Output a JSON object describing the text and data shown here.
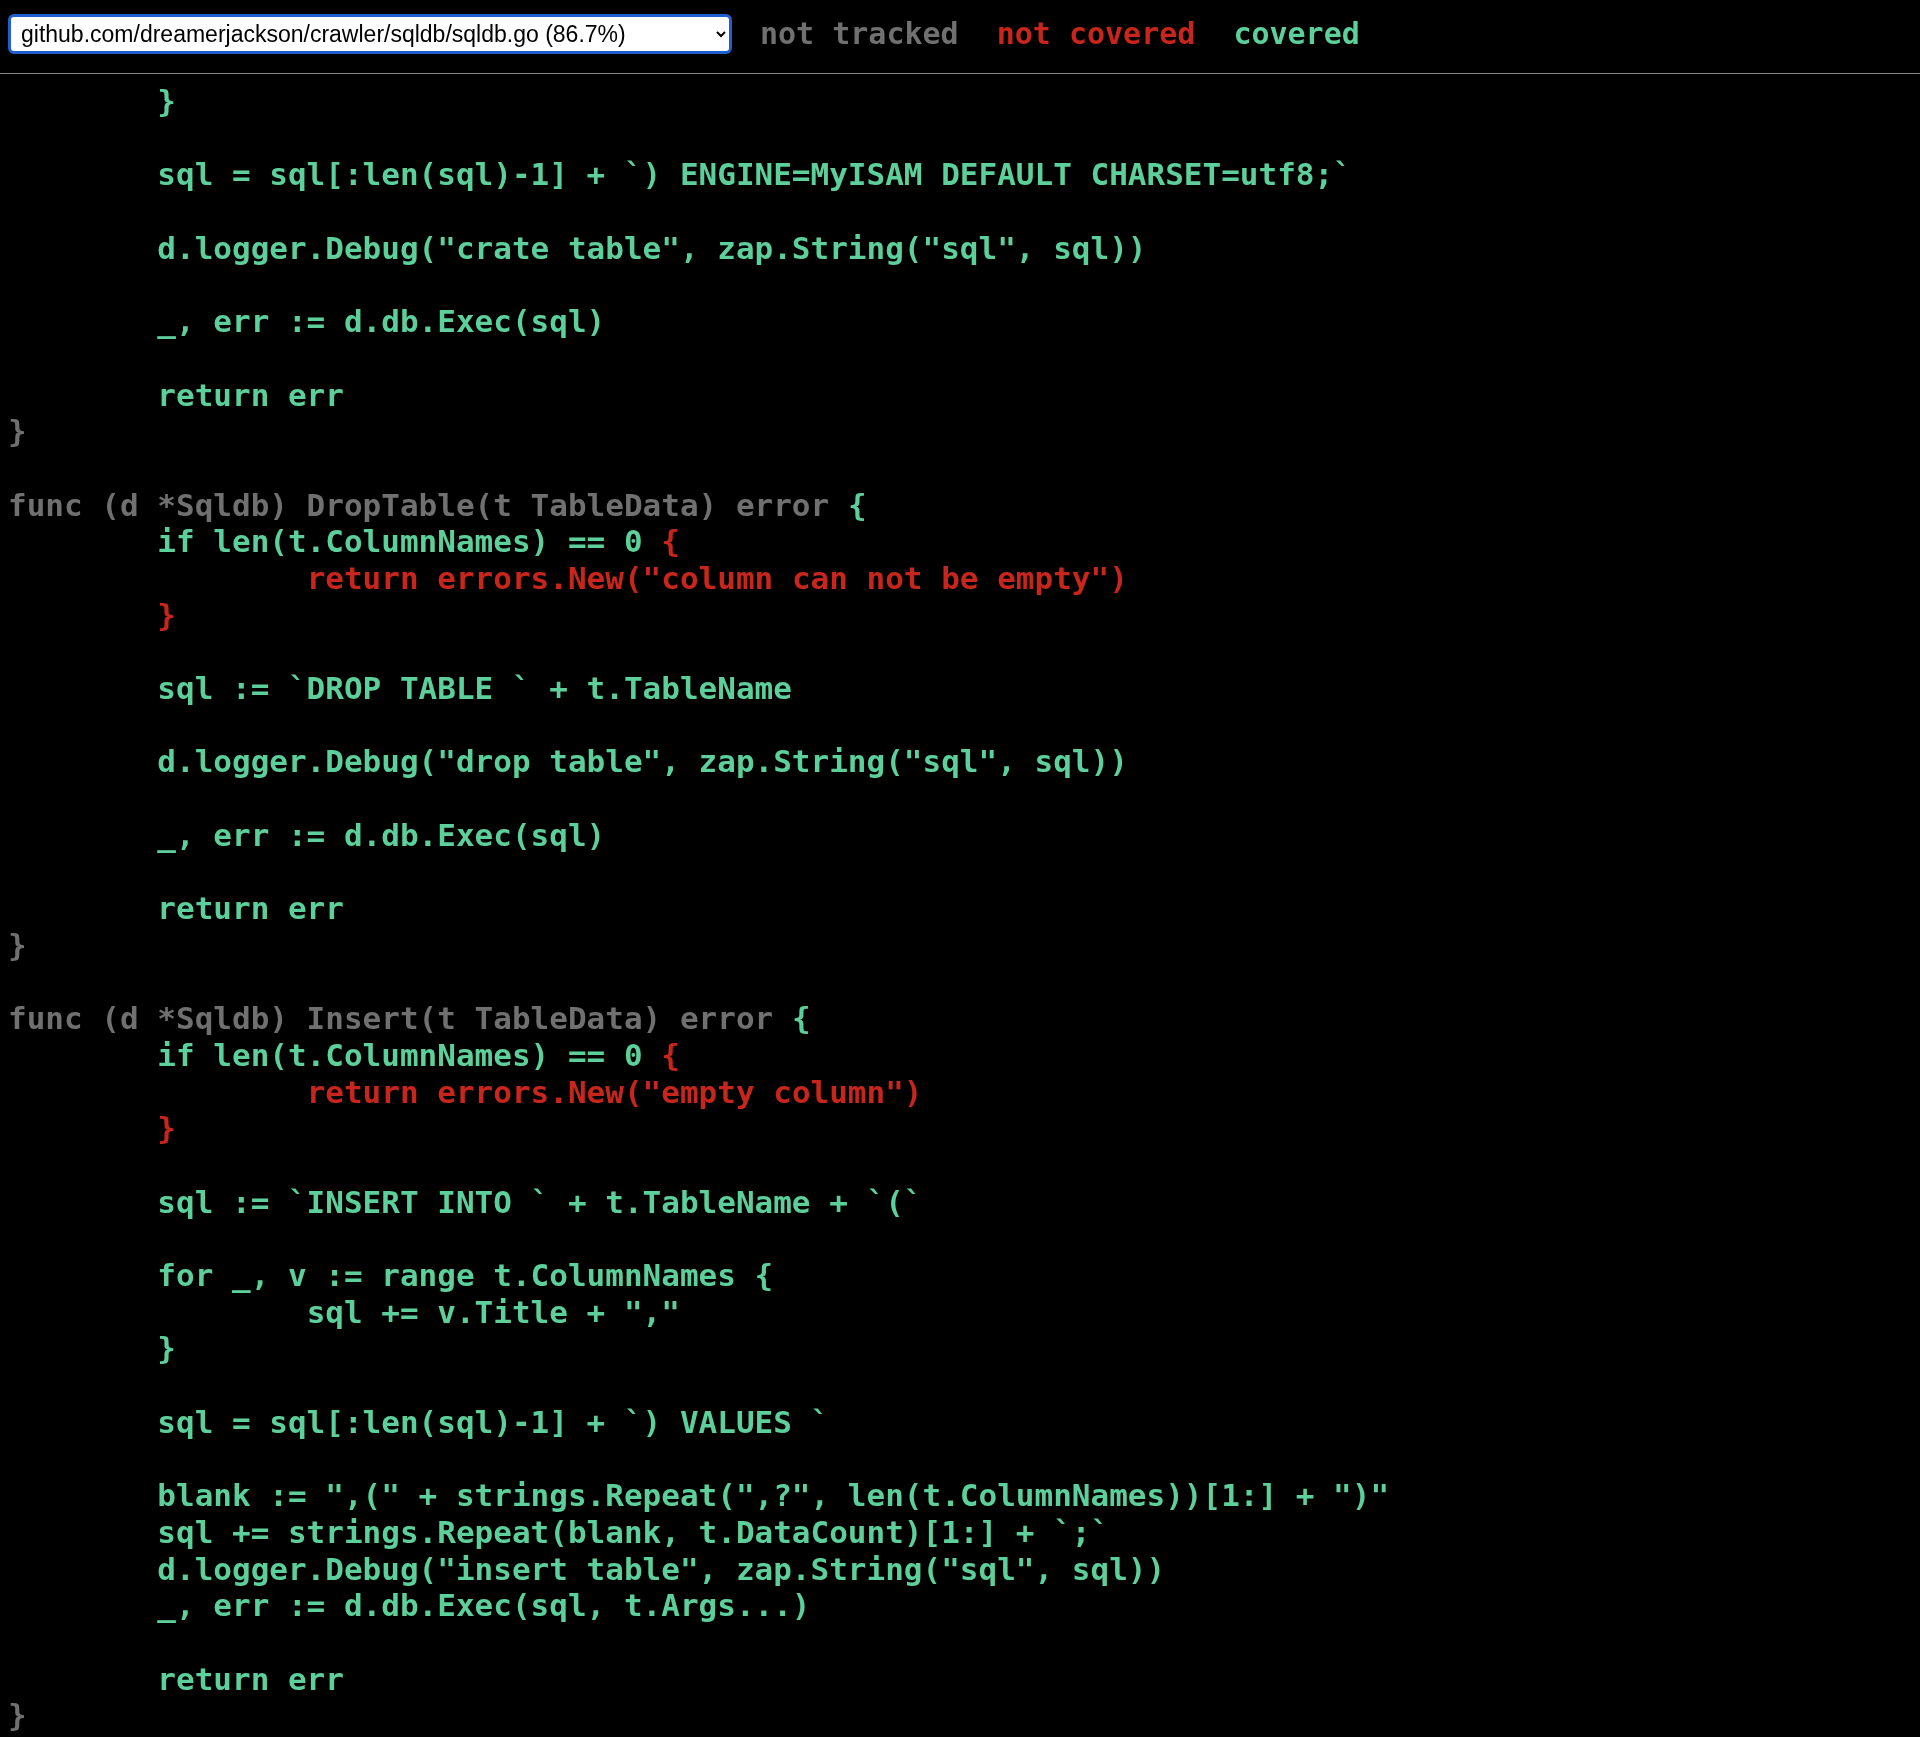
{
  "header": {
    "file_select": {
      "value": "github.com/dreamerjackson/crawler/sqldb/sqldb.go (86.7%)"
    },
    "legend": [
      {
        "label": "not tracked",
        "kind": "not-tracked"
      },
      {
        "label": "not covered",
        "kind": "not-covered"
      },
      {
        "label": "covered",
        "kind": "covered"
      }
    ]
  },
  "code": {
    "lines": [
      {
        "kind": "code",
        "segments": [
          {
            "text": "\t}",
            "kind": "covered"
          }
        ]
      },
      {
        "kind": "blank"
      },
      {
        "kind": "code",
        "segments": [
          {
            "text": "\tsql = sql[:len(sql)-1] + `) ENGINE=MyISAM DEFAULT CHARSET=utf8;`",
            "kind": "covered"
          }
        ]
      },
      {
        "kind": "blank"
      },
      {
        "kind": "code",
        "segments": [
          {
            "text": "\td.logger.Debug(\"crate table\", zap.String(\"sql\", sql))",
            "kind": "covered"
          }
        ]
      },
      {
        "kind": "blank"
      },
      {
        "kind": "code",
        "segments": [
          {
            "text": "\t_, err := d.db.Exec(sql)",
            "kind": "covered"
          }
        ]
      },
      {
        "kind": "blank"
      },
      {
        "kind": "code",
        "segments": [
          {
            "text": "\treturn err",
            "kind": "covered"
          }
        ]
      },
      {
        "kind": "code",
        "segments": [
          {
            "text": "}",
            "kind": "not-tracked"
          }
        ]
      },
      {
        "kind": "blank"
      },
      {
        "kind": "code",
        "segments": [
          {
            "text": "func (d *Sqldb) DropTable(t TableData) error ",
            "kind": "not-tracked"
          },
          {
            "text": "{",
            "kind": "covered"
          }
        ]
      },
      {
        "kind": "code",
        "segments": [
          {
            "text": "\tif len(t.ColumnNames) == 0 ",
            "kind": "covered"
          },
          {
            "text": "{",
            "kind": "not-covered"
          }
        ]
      },
      {
        "kind": "code",
        "segments": [
          {
            "text": "\t\treturn errors.New(\"column can not be empty\")",
            "kind": "not-covered"
          }
        ]
      },
      {
        "kind": "code",
        "segments": [
          {
            "text": "\t}",
            "kind": "not-covered"
          }
        ]
      },
      {
        "kind": "blank"
      },
      {
        "kind": "code",
        "segments": [
          {
            "text": "\tsql := `DROP TABLE ` + t.TableName",
            "kind": "covered"
          }
        ]
      },
      {
        "kind": "blank"
      },
      {
        "kind": "code",
        "segments": [
          {
            "text": "\td.logger.Debug(\"drop table\", zap.String(\"sql\", sql))",
            "kind": "covered"
          }
        ]
      },
      {
        "kind": "blank"
      },
      {
        "kind": "code",
        "segments": [
          {
            "text": "\t_, err := d.db.Exec(sql)",
            "kind": "covered"
          }
        ]
      },
      {
        "kind": "blank"
      },
      {
        "kind": "code",
        "segments": [
          {
            "text": "\treturn err",
            "kind": "covered"
          }
        ]
      },
      {
        "kind": "code",
        "segments": [
          {
            "text": "}",
            "kind": "not-tracked"
          }
        ]
      },
      {
        "kind": "blank"
      },
      {
        "kind": "code",
        "segments": [
          {
            "text": "func (d *Sqldb) Insert(t TableData) error ",
            "kind": "not-tracked"
          },
          {
            "text": "{",
            "kind": "covered"
          }
        ]
      },
      {
        "kind": "code",
        "segments": [
          {
            "text": "\tif len(t.ColumnNames) == 0 ",
            "kind": "covered"
          },
          {
            "text": "{",
            "kind": "not-covered"
          }
        ]
      },
      {
        "kind": "code",
        "segments": [
          {
            "text": "\t\treturn errors.New(\"empty column\")",
            "kind": "not-covered"
          }
        ]
      },
      {
        "kind": "code",
        "segments": [
          {
            "text": "\t}",
            "kind": "not-covered"
          }
        ]
      },
      {
        "kind": "blank"
      },
      {
        "kind": "code",
        "segments": [
          {
            "text": "\tsql := `INSERT INTO ` + t.TableName + `(`",
            "kind": "covered"
          }
        ]
      },
      {
        "kind": "blank"
      },
      {
        "kind": "code",
        "segments": [
          {
            "text": "\tfor _, v := range t.ColumnNames {",
            "kind": "covered"
          }
        ]
      },
      {
        "kind": "code",
        "segments": [
          {
            "text": "\t\tsql += v.Title + \",\"",
            "kind": "covered"
          }
        ]
      },
      {
        "kind": "code",
        "segments": [
          {
            "text": "\t}",
            "kind": "covered"
          }
        ]
      },
      {
        "kind": "blank"
      },
      {
        "kind": "code",
        "segments": [
          {
            "text": "\tsql = sql[:len(sql)-1] + `) VALUES `",
            "kind": "covered"
          }
        ]
      },
      {
        "kind": "blank"
      },
      {
        "kind": "code",
        "segments": [
          {
            "text": "\tblank := \",(\" + strings.Repeat(\",?\", len(t.ColumnNames))[1:] + \")\"",
            "kind": "covered"
          }
        ]
      },
      {
        "kind": "code",
        "segments": [
          {
            "text": "\tsql += strings.Repeat(blank, t.DataCount)[1:] + `;`",
            "kind": "covered"
          }
        ]
      },
      {
        "kind": "code",
        "segments": [
          {
            "text": "\td.logger.Debug(\"insert table\", zap.String(\"sql\", sql))",
            "kind": "covered"
          }
        ]
      },
      {
        "kind": "code",
        "segments": [
          {
            "text": "\t_, err := d.db.Exec(sql, t.Args...)",
            "kind": "covered"
          }
        ]
      },
      {
        "kind": "blank"
      },
      {
        "kind": "code",
        "segments": [
          {
            "text": "\treturn err",
            "kind": "covered"
          }
        ]
      },
      {
        "kind": "code",
        "segments": [
          {
            "text": "}",
            "kind": "not-tracked"
          }
        ]
      }
    ]
  }
}
